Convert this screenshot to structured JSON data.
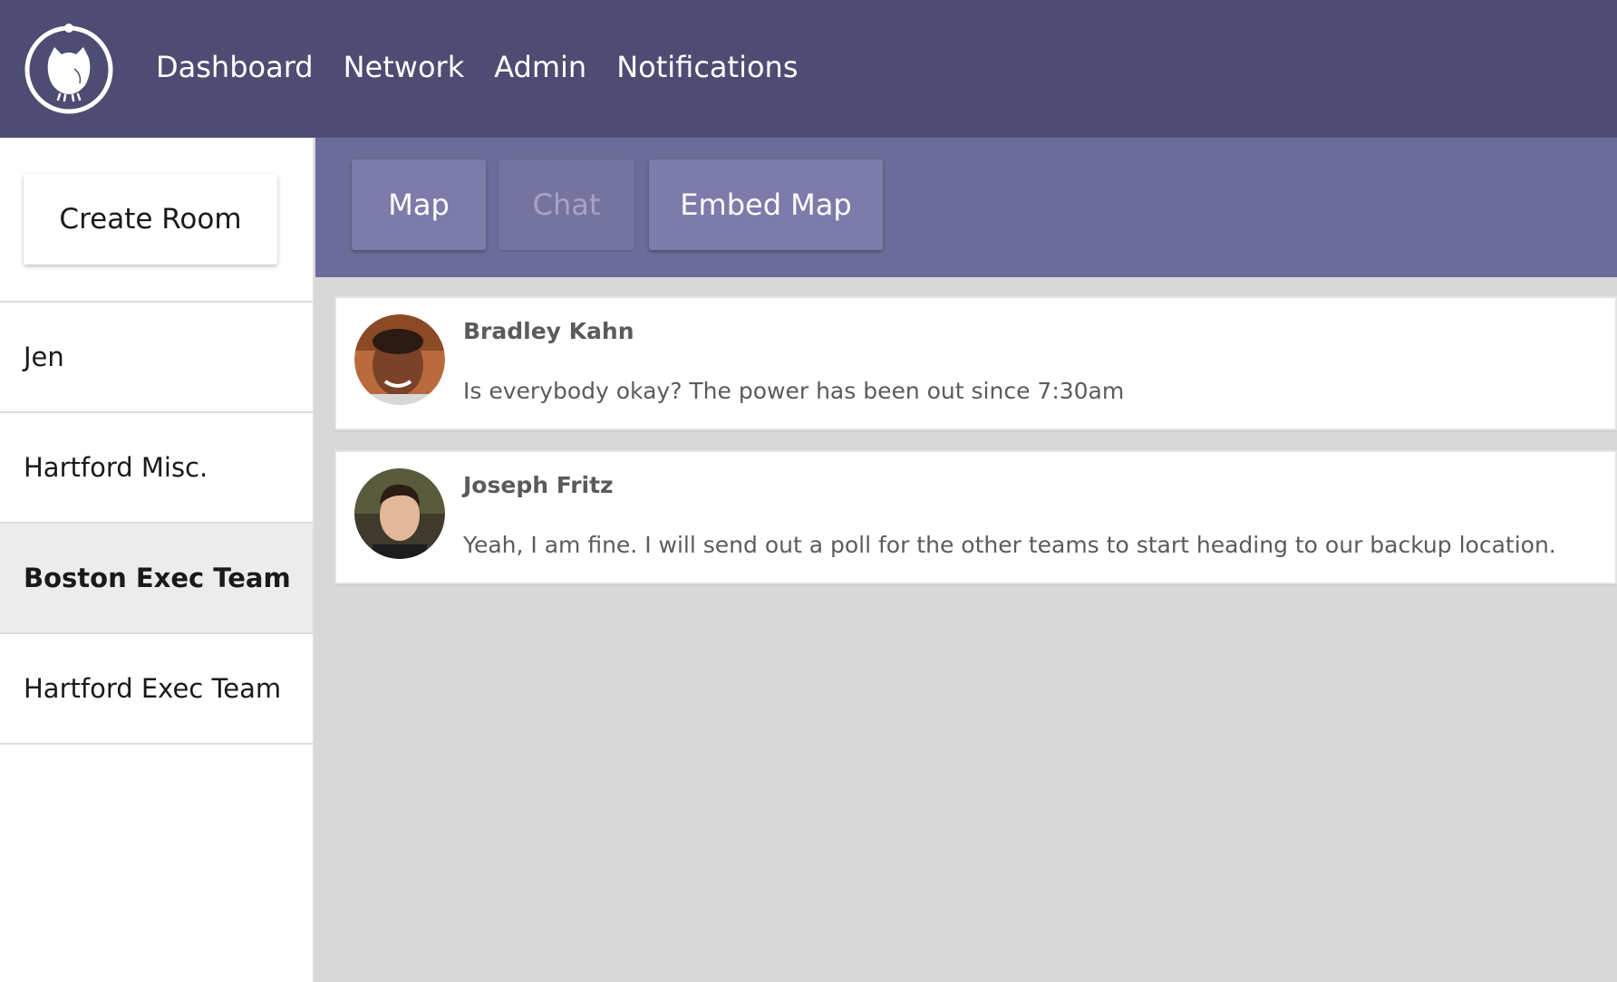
{
  "nav": {
    "items": [
      {
        "label": "Dashboard"
      },
      {
        "label": "Network"
      },
      {
        "label": "Admin"
      },
      {
        "label": "Notifications"
      }
    ],
    "logo_icon": "owl-logo-icon",
    "background_color": "#4e4c72"
  },
  "sidebar": {
    "create_room_label": "Create Room",
    "rooms": [
      {
        "label": "Jen",
        "active": false
      },
      {
        "label": "Hartford Misc.",
        "active": false
      },
      {
        "label": "Boston Exec Team",
        "active": true
      },
      {
        "label": "Hartford Exec Team",
        "active": false
      }
    ]
  },
  "tabs": [
    {
      "label": "Map",
      "enabled": true
    },
    {
      "label": "Chat",
      "enabled": false
    },
    {
      "label": "Embed Map",
      "enabled": true
    }
  ],
  "messages": [
    {
      "author": "Bradley Kahn",
      "text": "Is everybody okay? The power has been out since 7:30am",
      "avatar_icon": "user-avatar"
    },
    {
      "author": "Joseph Fritz",
      "text": "Yeah, I am fine. I will send out a poll for the other teams to start heading to our backup location.",
      "avatar_icon": "user-avatar"
    }
  ],
  "colors": {
    "accent": "#6c6c9b",
    "tab": "#7c7baa"
  }
}
